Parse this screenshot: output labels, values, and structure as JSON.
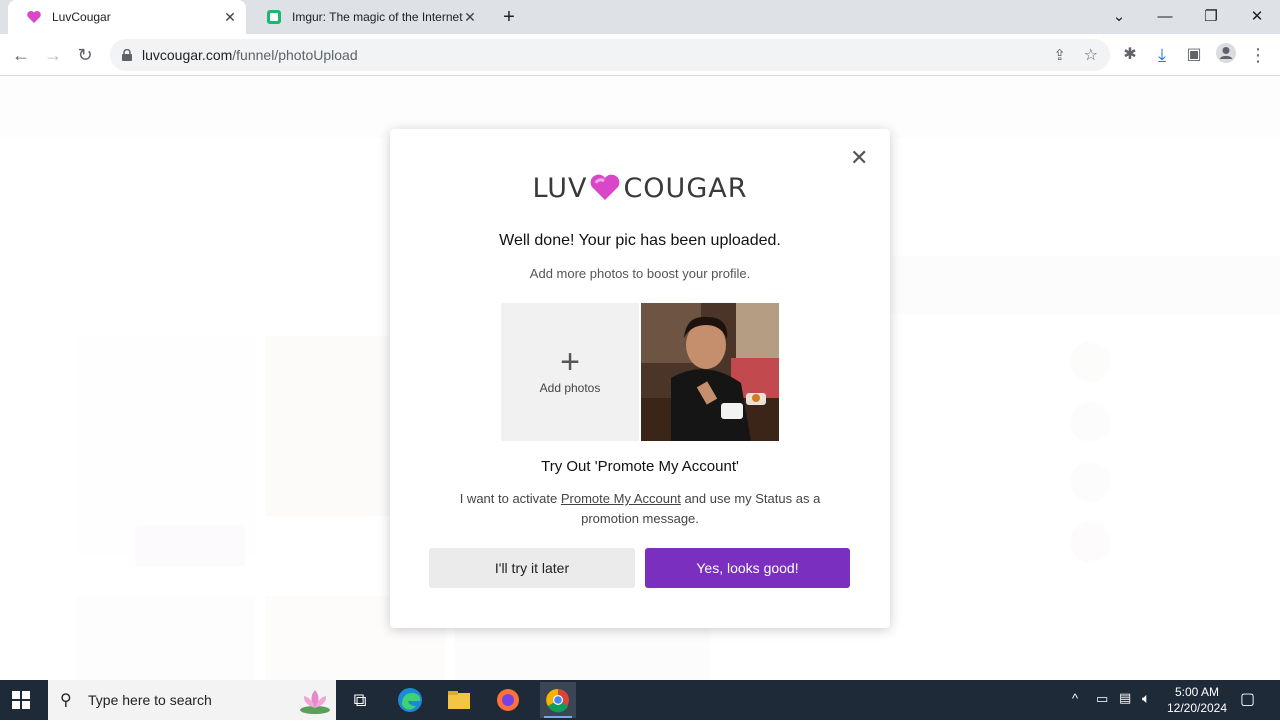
{
  "browser": {
    "tabs": [
      {
        "title": "LuvCougar",
        "active": true
      },
      {
        "title": "Imgur: The magic of the Internet",
        "active": false
      }
    ],
    "url_host": "luvcougar.com",
    "url_path": "/funnel/photoUpload"
  },
  "modal": {
    "logo_left": "LUV",
    "logo_right": "COUGAR",
    "title": "Well done! Your pic has been uploaded.",
    "subtitle": "Add more photos to boost your profile.",
    "add_photos_label": "Add photos",
    "promo_title": "Try Out 'Promote My Account'",
    "promo_text_before": "I want to activate ",
    "promo_link": "Promote My Account",
    "promo_text_after": " and use my Status as a promotion message.",
    "later_button": "I'll try it later",
    "confirm_button": "Yes, looks good!"
  },
  "taskbar": {
    "search_placeholder": "Type here to search",
    "time": "5:00 AM",
    "date": "12/20/2024"
  },
  "colors": {
    "accent": "#7b2fbf",
    "heart": "#d946c8"
  }
}
